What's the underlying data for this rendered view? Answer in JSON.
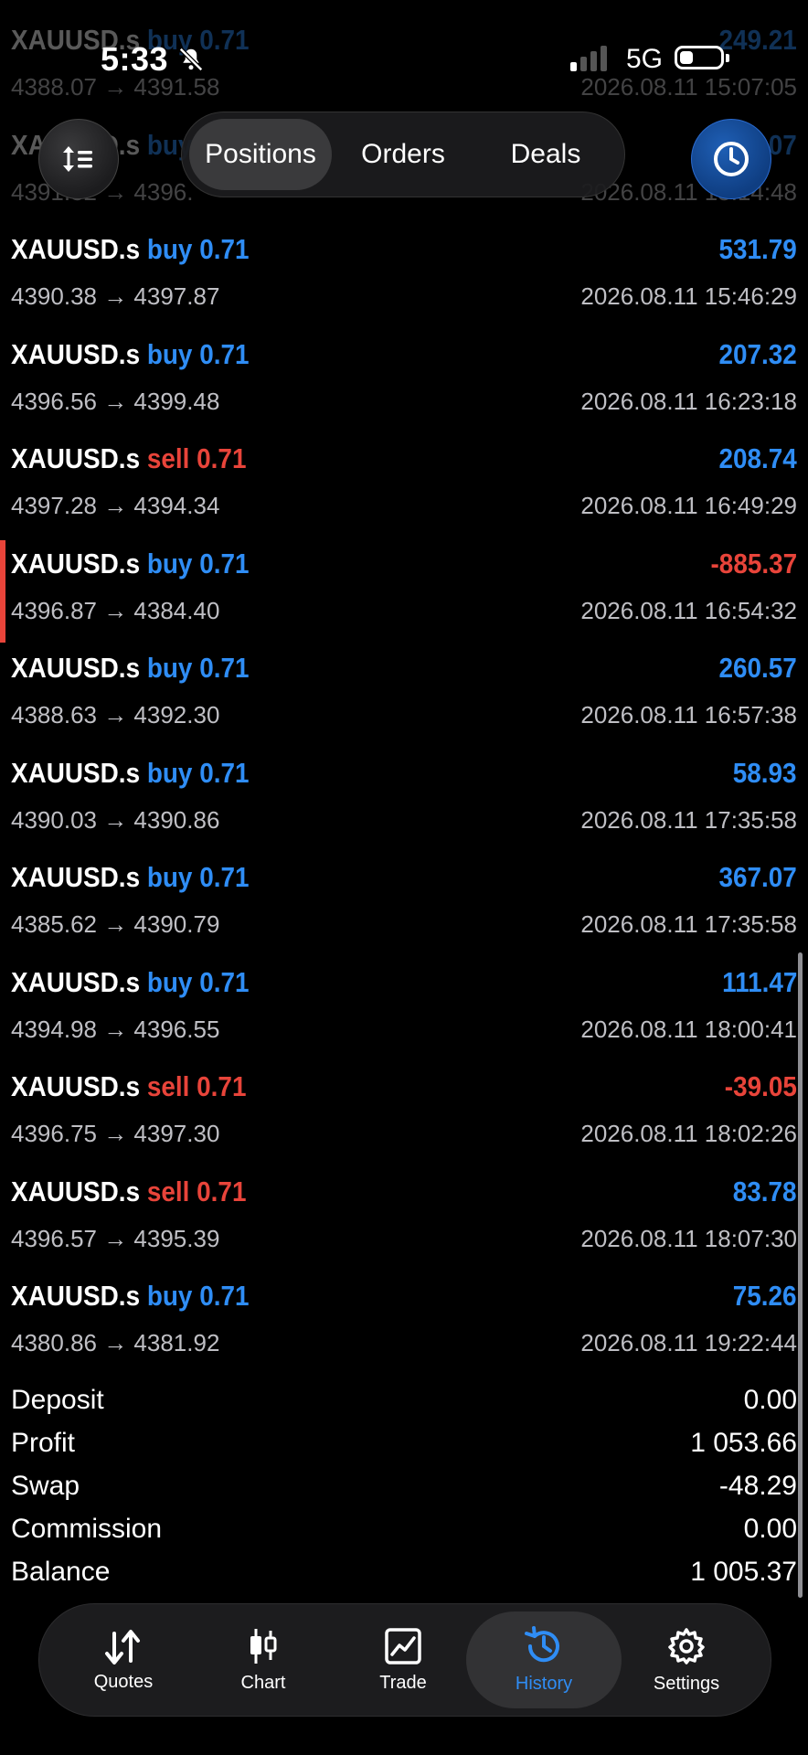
{
  "status_bar": {
    "time": "5:33",
    "network": "5G"
  },
  "toolbar": {
    "tabs": [
      {
        "label": "Positions",
        "active": true
      },
      {
        "label": "Orders",
        "active": false
      },
      {
        "label": "Deals",
        "active": false
      }
    ]
  },
  "deals": [
    {
      "symbol": "XAUUSD.s",
      "direction": "buy",
      "volume": "0.71",
      "prices": "4388.07 → 4391.58",
      "profit": "249.21",
      "datetime": "2026.08.11 15:07:05"
    },
    {
      "symbol": "XAUUSD.s",
      "direction": "buy",
      "volume": "0.71",
      "prices": "4391.32 → 4396.",
      "profit": "297.07",
      "datetime": "2026.08.11 15:14:48"
    },
    {
      "symbol": "XAUUSD.s",
      "direction": "buy",
      "volume": "0.71",
      "prices": "4390.38 → 4397.87",
      "profit": "531.79",
      "datetime": "2026.08.11 15:46:29"
    },
    {
      "symbol": "XAUUSD.s",
      "direction": "buy",
      "volume": "0.71",
      "prices": "4396.56 → 4399.48",
      "profit": "207.32",
      "datetime": "2026.08.11 16:23:18"
    },
    {
      "symbol": "XAUUSD.s",
      "direction": "sell",
      "volume": "0.71",
      "prices": "4397.28 → 4394.34",
      "profit": "208.74",
      "datetime": "2026.08.11 16:49:29"
    },
    {
      "symbol": "XAUUSD.s",
      "direction": "buy",
      "volume": "0.71",
      "prices": "4396.87 → 4384.40",
      "profit": "-885.37",
      "datetime": "2026.08.11 16:54:32"
    },
    {
      "symbol": "XAUUSD.s",
      "direction": "buy",
      "volume": "0.71",
      "prices": "4388.63 → 4392.30",
      "profit": "260.57",
      "datetime": "2026.08.11 16:57:38"
    },
    {
      "symbol": "XAUUSD.s",
      "direction": "buy",
      "volume": "0.71",
      "prices": "4390.03 → 4390.86",
      "profit": "58.93",
      "datetime": "2026.08.11 17:35:58"
    },
    {
      "symbol": "XAUUSD.s",
      "direction": "buy",
      "volume": "0.71",
      "prices": "4385.62 → 4390.79",
      "profit": "367.07",
      "datetime": "2026.08.11 17:35:58"
    },
    {
      "symbol": "XAUUSD.s",
      "direction": "buy",
      "volume": "0.71",
      "prices": "4394.98 → 4396.55",
      "profit": "111.47",
      "datetime": "2026.08.11 18:00:41"
    },
    {
      "symbol": "XAUUSD.s",
      "direction": "sell",
      "volume": "0.71",
      "prices": "4396.75 → 4397.30",
      "profit": "-39.05",
      "datetime": "2026.08.11 18:02:26"
    },
    {
      "symbol": "XAUUSD.s",
      "direction": "sell",
      "volume": "0.71",
      "prices": "4396.57 → 4395.39",
      "profit": "83.78",
      "datetime": "2026.08.11 18:07:30"
    },
    {
      "symbol": "XAUUSD.s",
      "direction": "buy",
      "volume": "0.71",
      "prices": "4380.86 → 4381.92",
      "profit": "75.26",
      "datetime": "2026.08.11 19:22:44"
    }
  ],
  "summary": [
    {
      "label": "Deposit",
      "value": "0.00"
    },
    {
      "label": "Profit",
      "value": "1 053.66"
    },
    {
      "label": "Swap",
      "value": "-48.29"
    },
    {
      "label": "Commission",
      "value": "0.00"
    },
    {
      "label": "Balance",
      "value": "1 005.37"
    }
  ],
  "nav": [
    {
      "label": "Quotes",
      "icon": "quotes-arrows-icon",
      "active": false
    },
    {
      "label": "Chart",
      "icon": "candlestick-icon",
      "active": false
    },
    {
      "label": "Trade",
      "icon": "trade-chart-icon",
      "active": false
    },
    {
      "label": "History",
      "icon": "history-clock-icon",
      "active": true
    },
    {
      "label": "Settings",
      "icon": "gear-icon",
      "active": false
    }
  ],
  "colors": {
    "buy": "#2f8df5",
    "sell": "#e8443a",
    "active_accent": "#2f8df5"
  }
}
